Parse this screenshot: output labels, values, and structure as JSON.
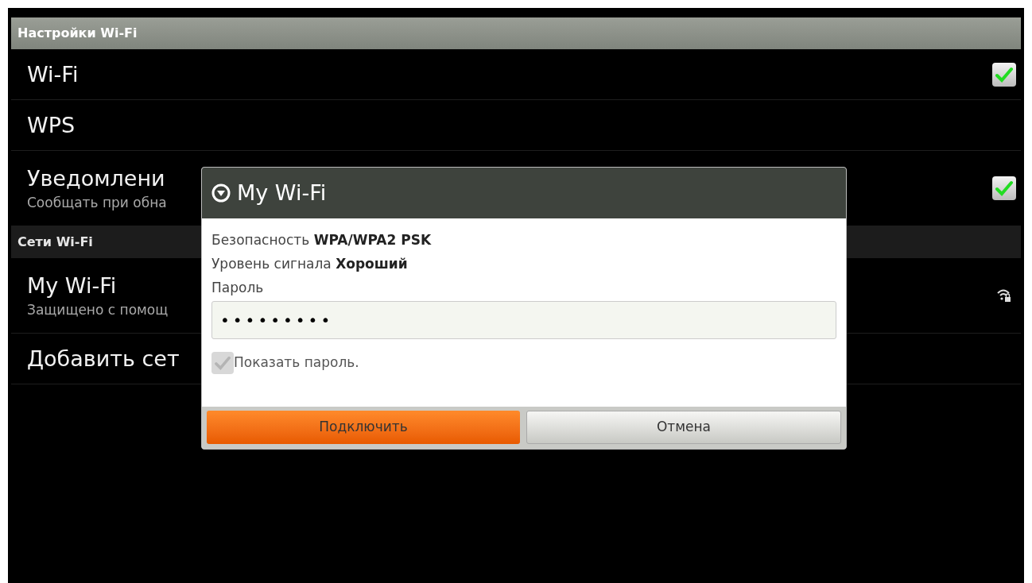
{
  "header": {
    "title": "Настройки Wi-Fi"
  },
  "settings": [
    {
      "kind": "toggle",
      "title": "Wi-Fi",
      "checked": true
    },
    {
      "kind": "plain",
      "title": "WPS"
    },
    {
      "kind": "toggle",
      "title": "Уведомлени",
      "subtitle": "Сообщать при обна",
      "checked": true
    }
  ],
  "networks_header": {
    "title": "Сети Wi-Fi"
  },
  "networks": [
    {
      "kind": "network",
      "title": "My Wi-Fi",
      "subtitle": "Защищено с помощ"
    },
    {
      "kind": "plain",
      "title": "Добавить сет"
    }
  ],
  "dialog": {
    "title": "My Wi-Fi",
    "details": [
      {
        "label": "Безопасность",
        "value": "WPA/WPA2 PSK"
      },
      {
        "label": "Уровень сигнала",
        "value": "Хороший"
      }
    ],
    "password_label": "Пароль",
    "password_value": "•••••••••",
    "show_password": {
      "label": "Показать пароль.",
      "checked": true,
      "disabled": true
    },
    "buttons": [
      {
        "label": "Подключить",
        "primary": true
      },
      {
        "label": "Отмена",
        "primary": false
      }
    ]
  }
}
